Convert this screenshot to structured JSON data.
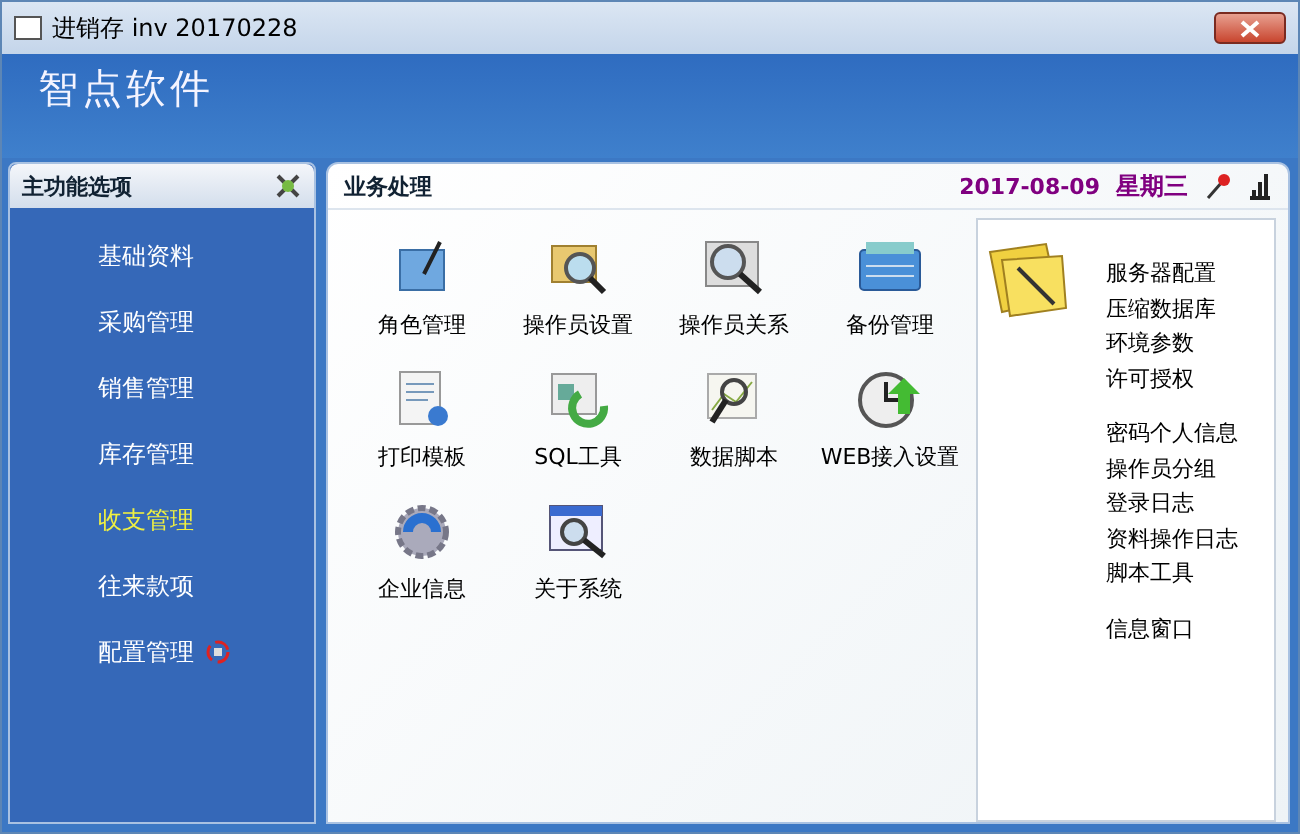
{
  "window": {
    "title": "进销存 inv 20170228"
  },
  "header": {
    "brand": "智点软件"
  },
  "sidebar": {
    "title": "主功能选项",
    "items": [
      {
        "label": "基础资料",
        "selected": false
      },
      {
        "label": "采购管理",
        "selected": false
      },
      {
        "label": "销售管理",
        "selected": false
      },
      {
        "label": "库存管理",
        "selected": false
      },
      {
        "label": "收支管理",
        "selected": true
      },
      {
        "label": "往来款项",
        "selected": false
      },
      {
        "label": "配置管理",
        "selected": false
      }
    ]
  },
  "main": {
    "title": "业务处理",
    "date": "2017-08-09",
    "weekday": "星期三",
    "tools": [
      {
        "label": "角色管理"
      },
      {
        "label": "操作员设置"
      },
      {
        "label": "操作员关系"
      },
      {
        "label": "备份管理"
      },
      {
        "label": "打印模板"
      },
      {
        "label": "SQL工具"
      },
      {
        "label": "数据脚本"
      },
      {
        "label": "WEB接入设置"
      },
      {
        "label": "企业信息"
      },
      {
        "label": "关于系统"
      }
    ],
    "links": [
      [
        "服务器配置",
        "压缩数据库",
        "环境参数",
        "许可授权"
      ],
      [
        "密码个人信息",
        "操作员分组",
        "登录日志",
        "资料操作日志",
        "脚本工具"
      ],
      [
        "信息窗口"
      ]
    ]
  }
}
